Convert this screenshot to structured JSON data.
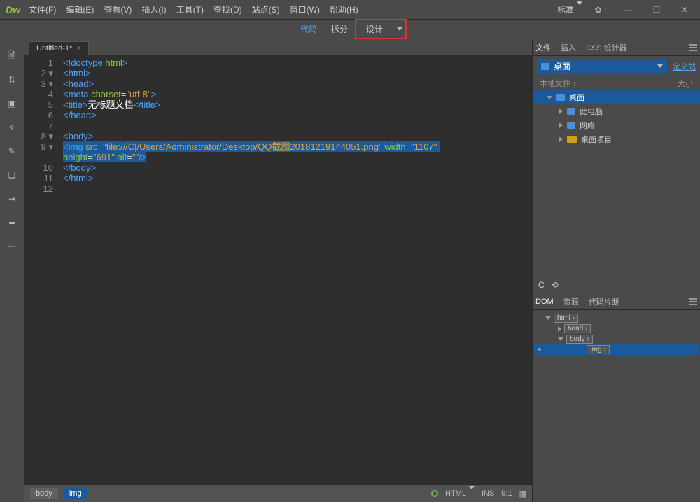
{
  "app": {
    "logo": "Dw"
  },
  "menubar": [
    "文件(F)",
    "编辑(E)",
    "查看(V)",
    "插入(I)",
    "工具(T)",
    "查找(D)",
    "站点(S)",
    "窗口(W)",
    "帮助(H)"
  ],
  "title_right": {
    "workspace": "标准"
  },
  "view_tabs": {
    "code": "代码",
    "split": "拆分",
    "design": "设计"
  },
  "filetab": {
    "name": "Untitled-1*"
  },
  "code_lines": [
    {
      "n": 1,
      "fold": "",
      "html": "<span class='tag'>&lt;!doctype</span> <span class='attr'>html</span><span class='tag'>&gt;</span>"
    },
    {
      "n": 2,
      "fold": "▾",
      "html": "<span class='tag'>&lt;html&gt;</span>"
    },
    {
      "n": 3,
      "fold": "▾",
      "html": "<span class='tag'>&lt;head&gt;</span>"
    },
    {
      "n": 4,
      "fold": "",
      "html": "<span class='tag'>&lt;meta</span> <span class='attr'>charset</span>=<span class='str'>\"utf-8\"</span><span class='tag'>&gt;</span>"
    },
    {
      "n": 5,
      "fold": "",
      "html": "<span class='tag'>&lt;title&gt;</span><span class='txt'>无标题文档</span><span class='tag'>&lt;/title&gt;</span>"
    },
    {
      "n": 6,
      "fold": "",
      "html": "<span class='tag'>&lt;/head&gt;</span>"
    },
    {
      "n": 7,
      "fold": "",
      "html": ""
    },
    {
      "n": 8,
      "fold": "▾",
      "html": "<span class='tag'>&lt;body&gt;</span>"
    },
    {
      "n": 9,
      "fold": "▾",
      "html": "<span class='sel'><span class='tag'>&lt;img</span> <span class='attr'>src</span>=<span class='str'>\"file:///C|/Users/Administrator/Desktop/QQ截图20181219144051.png\"</span> <span class='attr'>width</span>=<span class='str'>\"1107\"</span> </span>"
    },
    {
      "n": "",
      "fold": "",
      "html": "<span class='sel'><span class='attr'>height</span>=<span class='str'>\"691\"</span> <span class='attr'>alt</span>=<span class='str'>\"\"</span><span class='tag'>/&gt;</span></span>"
    },
    {
      "n": 10,
      "fold": "",
      "html": "<span class='tag'>&lt;/body&gt;</span>"
    },
    {
      "n": 11,
      "fold": "",
      "html": "<span class='tag'>&lt;/html&gt;</span>"
    },
    {
      "n": 12,
      "fold": "",
      "html": ""
    }
  ],
  "statusbar": {
    "crumbs": [
      "body",
      "img"
    ],
    "doctype": "HTML",
    "ins": "INS",
    "pos": "9:1"
  },
  "panels": {
    "files": {
      "tabs": [
        "文件",
        "插入",
        "CSS 设计器"
      ],
      "active": 0,
      "dropdown": "桌面",
      "define_link": "定义站",
      "local_label": "本地文件 ↑",
      "size_label": "大小",
      "tree": [
        {
          "indent": 0,
          "icon": "monitor",
          "label": "桌面",
          "selected": true,
          "exp": "down"
        },
        {
          "indent": 1,
          "icon": "monitor",
          "label": "此电脑",
          "exp": "right"
        },
        {
          "indent": 1,
          "icon": "monitor",
          "label": "网络",
          "exp": "right"
        },
        {
          "indent": 1,
          "icon": "folder",
          "label": "桌面项目",
          "exp": "right"
        }
      ]
    },
    "dom": {
      "tabs": [
        "DOM",
        "资源",
        "代码片断"
      ],
      "active": 0,
      "tree": [
        {
          "indent": 0,
          "label": "html",
          "exp": "down"
        },
        {
          "indent": 1,
          "label": "head",
          "exp": "right"
        },
        {
          "indent": 1,
          "label": "body",
          "exp": "down"
        },
        {
          "indent": 2,
          "label": "img",
          "selected": true
        }
      ]
    }
  }
}
